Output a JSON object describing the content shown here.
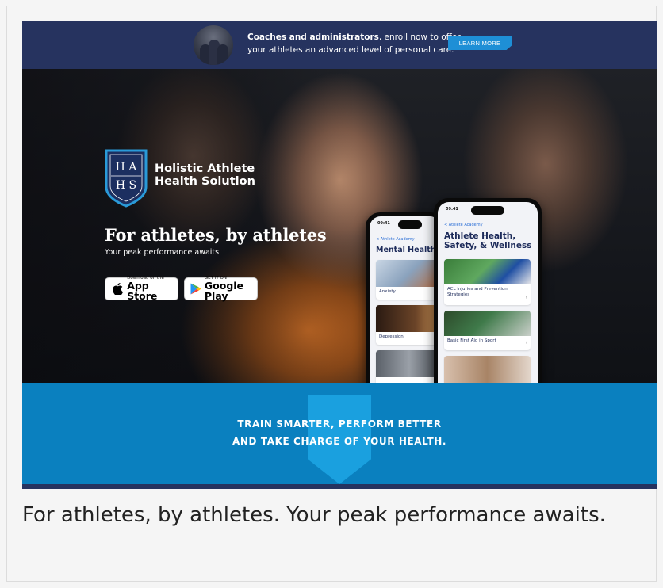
{
  "banner": {
    "bold_text": "Coaches and administrators",
    "rest_text": ", enroll now to offer your athletes an advanced level of personal care.",
    "button_label": "LEARN MORE",
    "colors": {
      "background": "#26335f",
      "button": "#1e8fd6"
    }
  },
  "hero": {
    "logo_letters": {
      "top": "H A",
      "bottom": "H S"
    },
    "brand_line1": "Holistic Athlete",
    "brand_line2": "Health Solution",
    "title": "For athletes, by athletes",
    "subtitle": "Your peak performance awaits",
    "app_store": {
      "small": "Download on the",
      "big": "App Store",
      "icon": "apple-icon"
    },
    "google_play": {
      "small": "GET IT ON",
      "big": "Google Play",
      "icon": "play-icon"
    }
  },
  "phone_back": {
    "time": "09:41",
    "back_label": "< Athlete Academy",
    "title": "Mental Health",
    "cards": [
      {
        "label": "Anxiety"
      },
      {
        "label": "Depression"
      },
      {
        "label": ""
      }
    ]
  },
  "phone_front": {
    "time": "09:41",
    "back_label": "< Athlete Academy",
    "title_line1": "Athlete Health,",
    "title_line2": "Safety, & Wellness",
    "cards": [
      {
        "label": "ACL Injuries and Prevention Strategies"
      },
      {
        "label": "Basic First Aid in Sport"
      },
      {
        "label": ""
      }
    ]
  },
  "band": {
    "line1": "TRAIN SMARTER, PERFORM BETTER",
    "line2": "AND TAKE CHARGE OF YOUR HEALTH.",
    "colors": {
      "background": "#0a80bf",
      "shield": "#1aa0df"
    }
  },
  "caption": "For athletes, by athletes. Your peak performance awaits."
}
